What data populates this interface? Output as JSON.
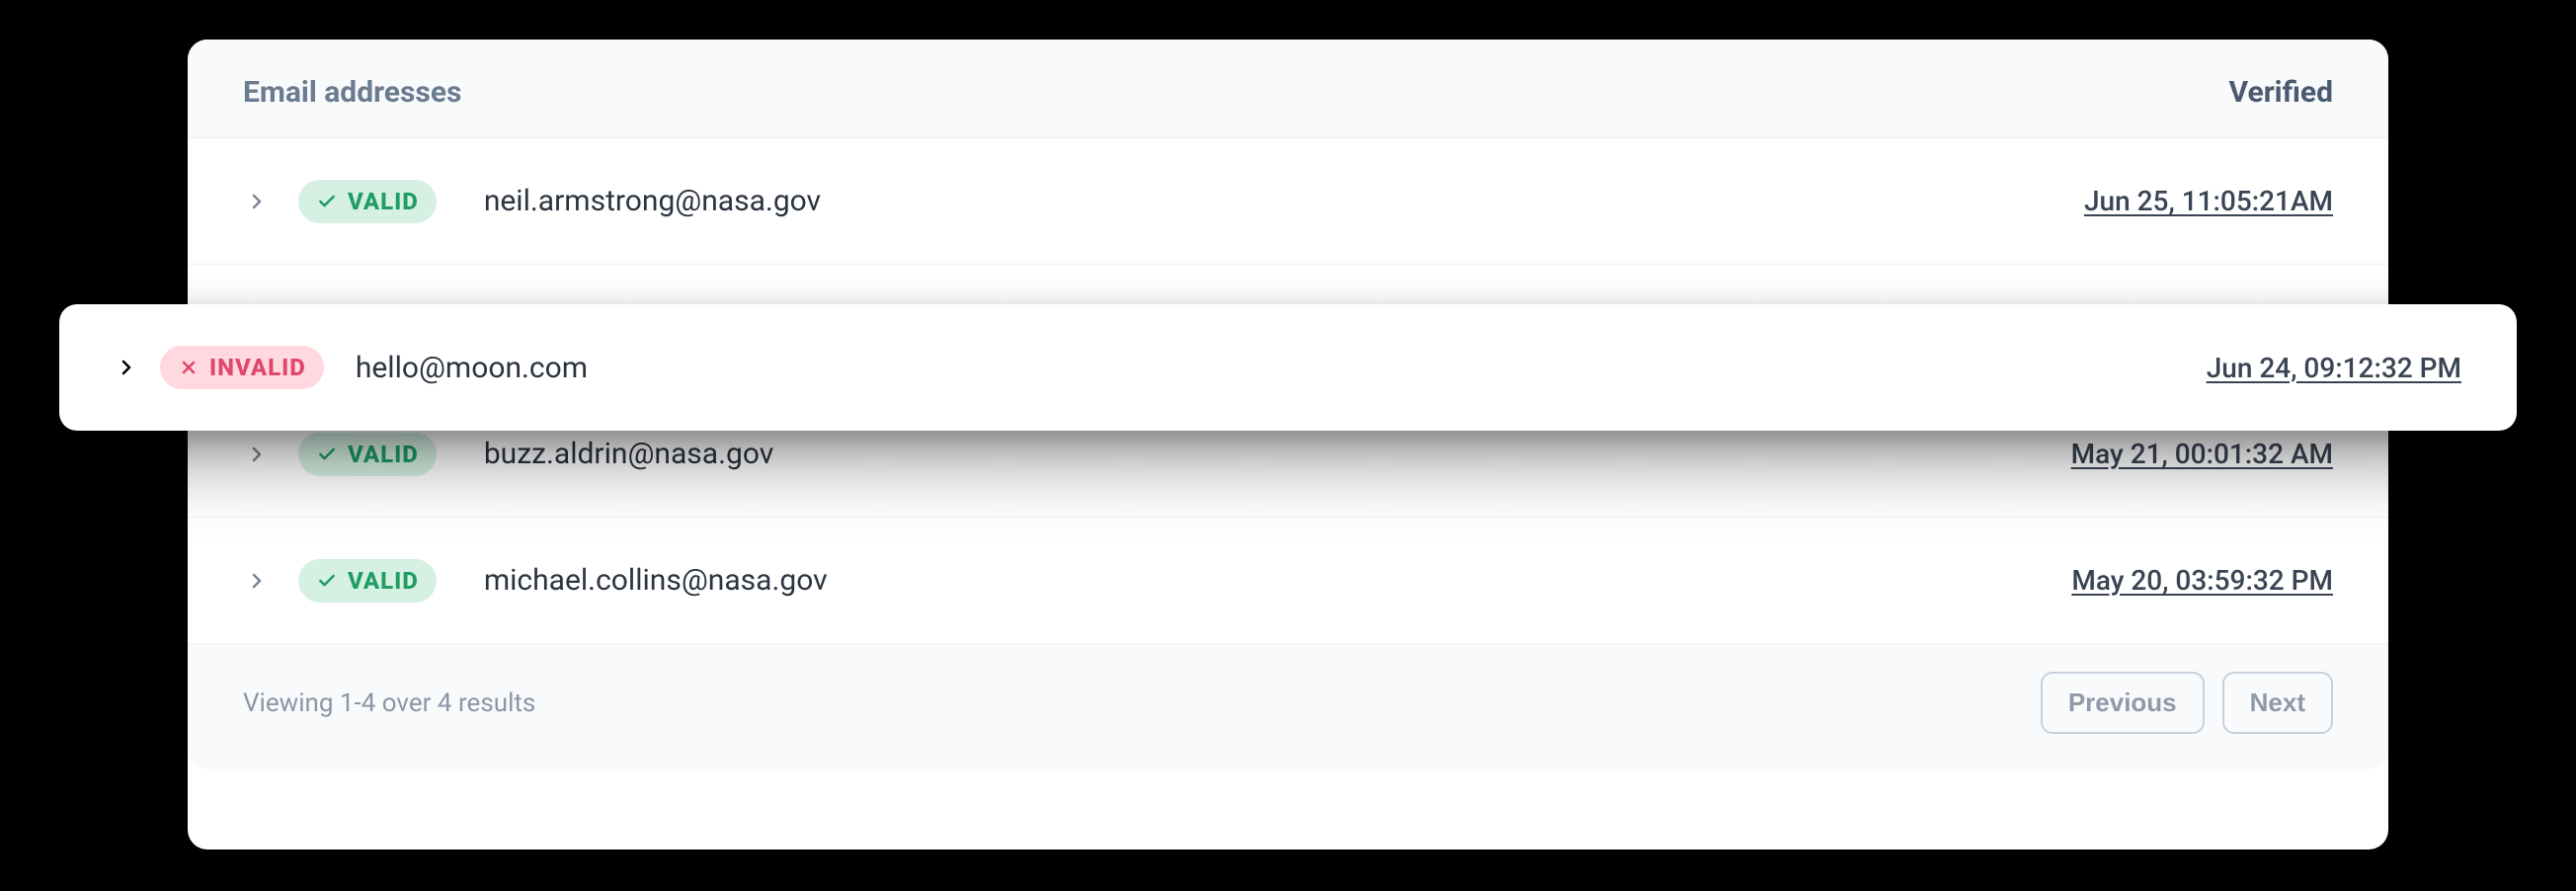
{
  "header": {
    "title": "Email addresses",
    "verified_label": "Verified"
  },
  "badges": {
    "valid": "VALID",
    "invalid": "INVALID"
  },
  "rows": [
    {
      "status": "valid",
      "email": "neil.armstrong@nasa.gov",
      "verified": "Jun 25, 11:05:21AM"
    },
    {
      "status": "invalid",
      "email": "hello@moon.com",
      "verified": "Jun 24, 09:12:32 PM"
    },
    {
      "status": "valid",
      "email": "buzz.aldrin@nasa.gov",
      "verified": "May 21, 00:01:32 AM"
    },
    {
      "status": "valid",
      "email": "michael.collins@nasa.gov",
      "verified": "May 20, 03:59:32 PM"
    }
  ],
  "footer": {
    "summary": "Viewing 1-4 over 4 results",
    "prev": "Previous",
    "next": "Next"
  }
}
